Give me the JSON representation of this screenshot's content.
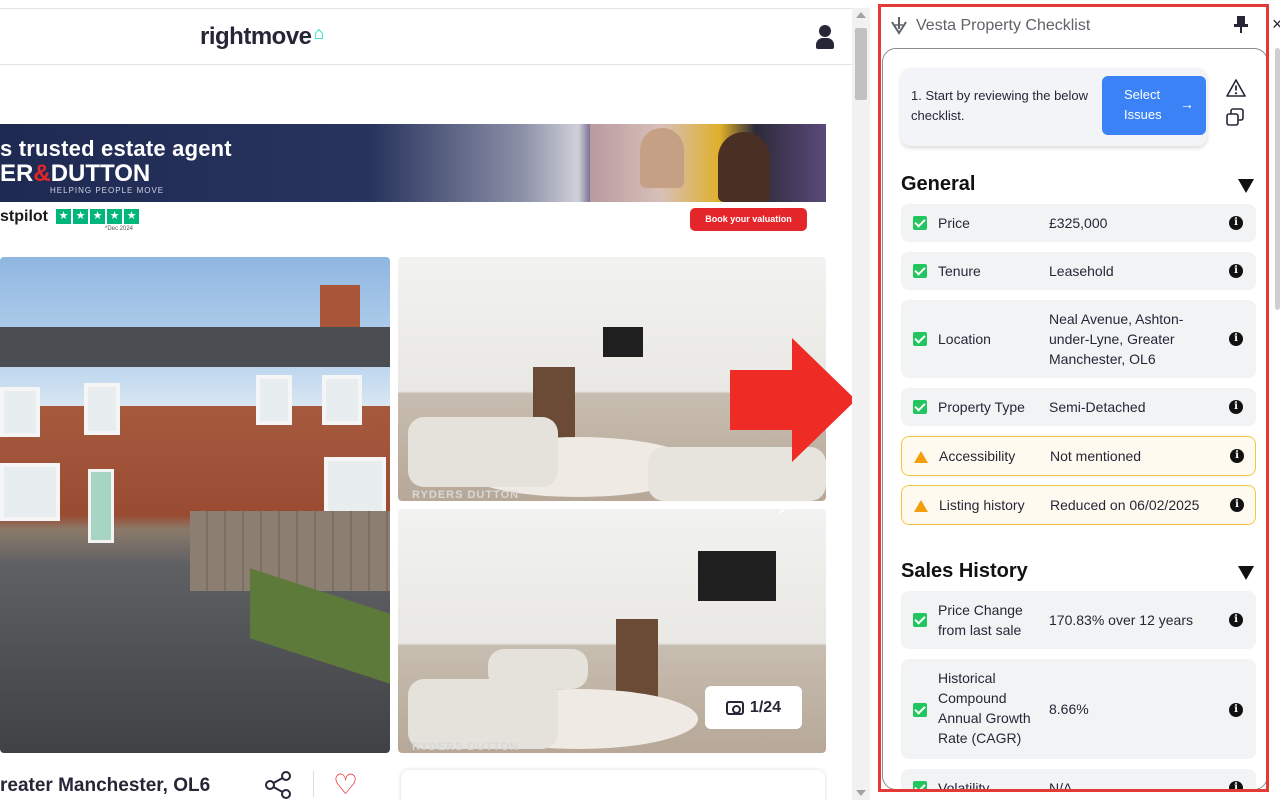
{
  "rightmove": {
    "logo": "rightmove",
    "logo_house": "⌂",
    "banner": {
      "line1": "s trusted estate agent",
      "line2_pre": "ER",
      "line2_amp": "&",
      "line2_post": "DUTTON",
      "tagline": "HELPING PEOPLE MOVE",
      "trustpilot": "stpilot",
      "trustpilot_date": "*Dec 2024",
      "cta": "Book your valuation"
    },
    "watermark": "RYDERS DUTTON",
    "photo_counter": "1/24",
    "address": "reater Manchester, OL6"
  },
  "extension": {
    "title": "Vesta Property Checklist",
    "step": {
      "text": "1. Start by reviewing the below checklist.",
      "button": "Select Issues",
      "button_arrow": "→"
    },
    "sections": {
      "general": {
        "title": "General",
        "rows": [
          {
            "label": "Price",
            "value": "£325,000",
            "status": "ok"
          },
          {
            "label": "Tenure",
            "value": "Leasehold",
            "status": "ok"
          },
          {
            "label": "Location",
            "value": "Neal Avenue, Ashton-under-Lyne, Greater Manchester, OL6",
            "status": "ok"
          },
          {
            "label": "Property Type",
            "value": "Semi-Detached",
            "status": "ok"
          },
          {
            "label": "Accessibility",
            "value": "Not mentioned",
            "status": "warn"
          },
          {
            "label": "Listing history",
            "value": "Reduced on 06/02/2025",
            "status": "warn"
          }
        ]
      },
      "sales_history": {
        "title": "Sales History",
        "rows": [
          {
            "label": "Price Change from last sale",
            "value": "170.83% over 12 years",
            "status": "ok"
          },
          {
            "label": "Historical Compound Annual Growth Rate (CAGR)",
            "value": "8.66%",
            "status": "ok"
          },
          {
            "label": "Volatility",
            "value": "N/A",
            "status": "ok"
          }
        ]
      }
    },
    "info_glyph": "i"
  },
  "colors": {
    "accent_blue": "#3b82f6",
    "check_green": "#22c55e",
    "warn_amber": "#f59e0b",
    "highlight_red": "#e53935"
  }
}
